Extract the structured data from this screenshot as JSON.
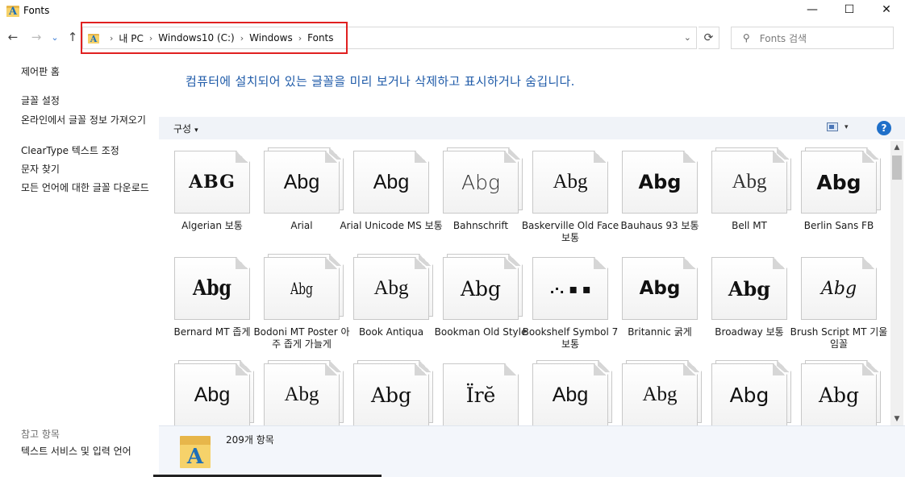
{
  "window": {
    "title": "Fonts",
    "minimize": "—",
    "maximize": "☐",
    "close": "✕",
    "icon_letter": "A"
  },
  "nav": {
    "back": "←",
    "forward": "→",
    "recent": "⌄",
    "up": "↑"
  },
  "address": {
    "crumbs": [
      "내 PC",
      "Windows10 (C:)",
      "Windows",
      "Fonts"
    ],
    "separator": "›",
    "dropdown": "⌄",
    "refresh": "⟳",
    "icon_letter": "A"
  },
  "search": {
    "placeholder": "Fonts 검색",
    "icon": "⚲"
  },
  "sidebar": {
    "home": "제어판 홈",
    "links": [
      "글꼴 설정",
      "온라인에서 글꼴 정보 가져오기",
      "ClearType 텍스트 조정",
      "문자 찾기",
      "모든 언어에 대한 글꼴 다운로드"
    ],
    "see_also_title": "참고 항목",
    "see_also": [
      "텍스트 서비스 및 입력 언어"
    ]
  },
  "header": {
    "description": "컴퓨터에 설치되어 있는 글꼴을 미리 보거나 삭제하고 표시하거나 숨깁니다."
  },
  "toolbar": {
    "organize": "구성",
    "caret": "▾",
    "help": "?"
  },
  "fonts": [
    {
      "name": "Algerian 보통",
      "sample": "ABG"
    },
    {
      "name": "Arial",
      "sample": "Abg"
    },
    {
      "name": "Arial Unicode MS 보통",
      "sample": "Abg"
    },
    {
      "name": "Bahnschrift",
      "sample": "Abg"
    },
    {
      "name": "Baskerville Old Face 보통",
      "sample": "Abg"
    },
    {
      "name": "Bauhaus 93 보통",
      "sample": "Abg"
    },
    {
      "name": "Bell MT",
      "sample": "Abg"
    },
    {
      "name": "Berlin Sans FB",
      "sample": "Abg"
    },
    {
      "name": "Bernard MT 좁게",
      "sample": "Abg"
    },
    {
      "name": "Bodoni MT Poster 아주 좁게 가늘게",
      "sample": "Abg"
    },
    {
      "name": "Book Antiqua",
      "sample": "Abg"
    },
    {
      "name": "Bookman Old Style",
      "sample": "Abg"
    },
    {
      "name": "Bookshelf Symbol 7 보통",
      "sample": ".·.  ▪  ▪"
    },
    {
      "name": "Britannic 굵게",
      "sample": "Abg"
    },
    {
      "name": "Broadway 보통",
      "sample": "Abg"
    },
    {
      "name": "Brush Script MT 기울임꼴",
      "sample": "Abg"
    },
    {
      "name": "",
      "sample": "Abg"
    },
    {
      "name": "",
      "sample": "Abg"
    },
    {
      "name": "",
      "sample": "Abg"
    },
    {
      "name": "",
      "sample": "Ïrĕ"
    },
    {
      "name": "",
      "sample": "Abg"
    },
    {
      "name": "",
      "sample": "Abg"
    },
    {
      "name": "",
      "sample": "Abg"
    },
    {
      "name": "",
      "sample": "Abg"
    }
  ],
  "scroll": {
    "up": "▲",
    "down": "▼"
  },
  "details": {
    "count": "209개 항목",
    "icon_letter": "A"
  }
}
